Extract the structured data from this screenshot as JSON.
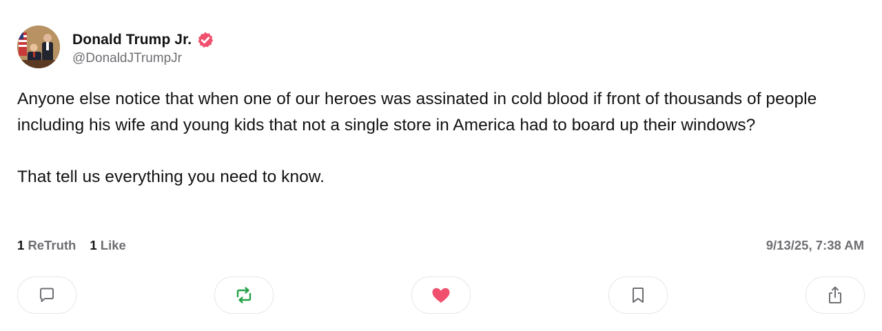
{
  "post": {
    "author": {
      "display_name": "Donald Trump Jr.",
      "handle": "@DonaldJTrumpJr",
      "verified_icon": "verified-badge-icon",
      "verified_color": "#f0506e"
    },
    "text": "Anyone else notice that when one of our heroes was assinated in cold blood if front of thousands of people including his wife and young kids that not a single store in America had to board up their windows?\n\nThat tell us everything you need to know.",
    "stats": {
      "retruth_count": "1",
      "retruth_label": "ReTruth",
      "like_count": "1",
      "like_label": "Like"
    },
    "timestamp": "9/13/25, 7:38 AM"
  },
  "actions": [
    {
      "name": "reply",
      "icon": "comment-icon",
      "color": "#6e6e73"
    },
    {
      "name": "retruth",
      "icon": "retruth-icon",
      "color": "#22a046"
    },
    {
      "name": "like",
      "icon": "heart-icon",
      "color": "#f0506e"
    },
    {
      "name": "bookmark",
      "icon": "bookmark-icon",
      "color": "#6e6e73"
    },
    {
      "name": "share",
      "icon": "share-icon",
      "color": "#6e6e73"
    }
  ]
}
